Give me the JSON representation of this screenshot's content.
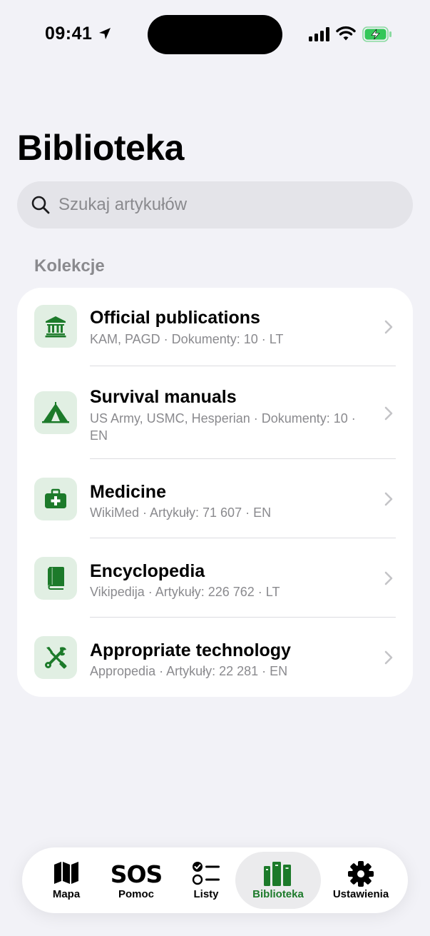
{
  "status_bar": {
    "time": "09:41"
  },
  "header": {
    "title": "Biblioteka"
  },
  "search": {
    "placeholder": "Szukaj artykułów",
    "icon": "search-icon"
  },
  "section": {
    "title": "Kolekcje"
  },
  "collections": [
    {
      "title": "Official publications",
      "subtitle": "KAM, PAGD · Dokumenty: 10 · LT",
      "icon": "bank-icon"
    },
    {
      "title": "Survival manuals",
      "subtitle": "US Army, USMC, Hesperian · Dokumenty: 10 · EN",
      "icon": "tent-icon"
    },
    {
      "title": "Medicine",
      "subtitle": "WikiMed · Artykuły: 71 607 · EN",
      "icon": "medical-kit-icon"
    },
    {
      "title": "Encyclopedia",
      "subtitle": "Vikipedija · Artykuły: 226 762 · LT",
      "icon": "book-icon"
    },
    {
      "title": "Appropriate technology",
      "subtitle": "Appropedia · Artykuły: 22 281 · EN",
      "icon": "tools-icon"
    }
  ],
  "tabbar": {
    "active": "Biblioteka",
    "tabs": [
      {
        "label": "Mapa",
        "icon": "map-icon"
      },
      {
        "label": "Pomoc",
        "icon_text": "SOS",
        "icon": "sos-icon"
      },
      {
        "label": "Listy",
        "icon": "checklist-icon"
      },
      {
        "label": "Biblioteka",
        "icon": "library-icon"
      },
      {
        "label": "Ustawienia",
        "icon": "gear-icon"
      }
    ]
  },
  "colors": {
    "accent": "#1c7a2a",
    "icon_bg": "#e1efe3",
    "background": "#f2f2f7",
    "battery": "#34c759"
  }
}
